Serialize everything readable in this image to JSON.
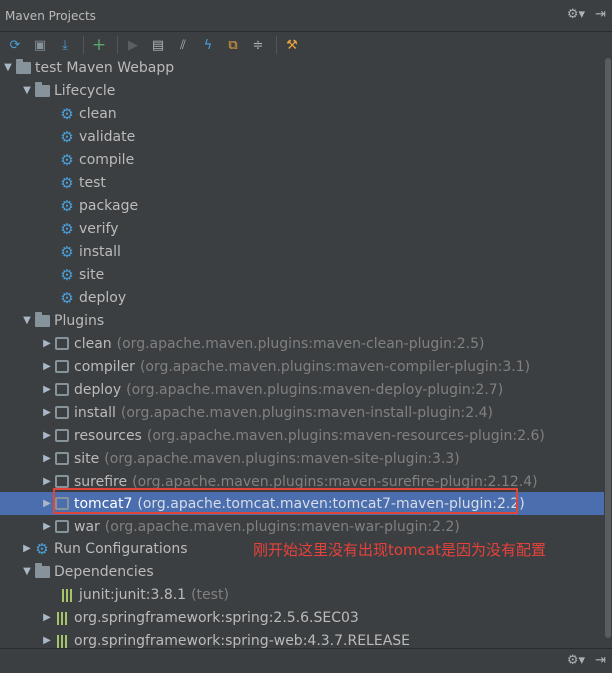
{
  "window": {
    "title": "Maven Projects"
  },
  "toolbar": {
    "icons": [
      "refresh-icon",
      "generate-sources-icon",
      "download-icon",
      "add-icon",
      "run-icon",
      "execute-goal-icon",
      "toggle-offline-icon",
      "skip-tests-icon",
      "show-dependencies-icon",
      "collapse-all-icon",
      "settings-icon"
    ]
  },
  "tree": {
    "project": "test Maven Webapp",
    "lifecycle": {
      "label": "Lifecycle",
      "goals": [
        "clean",
        "validate",
        "compile",
        "test",
        "package",
        "verify",
        "install",
        "site",
        "deploy"
      ]
    },
    "plugins": {
      "label": "Plugins",
      "items": [
        {
          "name": "clean",
          "detail": "(org.apache.maven.plugins:maven-clean-plugin:2.5)"
        },
        {
          "name": "compiler",
          "detail": "(org.apache.maven.plugins:maven-compiler-plugin:3.1)"
        },
        {
          "name": "deploy",
          "detail": "(org.apache.maven.plugins:maven-deploy-plugin:2.7)"
        },
        {
          "name": "install",
          "detail": "(org.apache.maven.plugins:maven-install-plugin:2.4)"
        },
        {
          "name": "resources",
          "detail": "(org.apache.maven.plugins:maven-resources-plugin:2.6)"
        },
        {
          "name": "site",
          "detail": "(org.apache.maven.plugins:maven-site-plugin:3.3)"
        },
        {
          "name": "surefire",
          "detail": "(org.apache.maven.plugins:maven-surefire-plugin:2.12.4)"
        },
        {
          "name": "tomcat7",
          "detail": "(org.apache.tomcat.maven:tomcat7-maven-plugin:2.2)"
        },
        {
          "name": "war",
          "detail": "(org.apache.maven.plugins:maven-war-plugin:2.2)"
        }
      ]
    },
    "run_configurations": {
      "label": "Run Configurations"
    },
    "dependencies": {
      "label": "Dependencies",
      "items": [
        {
          "name": "junit:junit:3.8.1",
          "detail": "(test)"
        },
        {
          "name": "org.springframework:spring:2.5.6.SEC03",
          "detail": ""
        },
        {
          "name": "org.springframework:spring-web:4.3.7.RELEASE",
          "detail": ""
        }
      ]
    }
  },
  "annotation": {
    "text": "刚开始这里没有出现tomcat是因为没有配置",
    "color": "#e8413b"
  },
  "colors": {
    "background": "#3c3f41",
    "selection": "#4b6eaf",
    "gear": "#4a9fd8",
    "library": "#a6c46a",
    "highlight_box": "#e0453a"
  }
}
